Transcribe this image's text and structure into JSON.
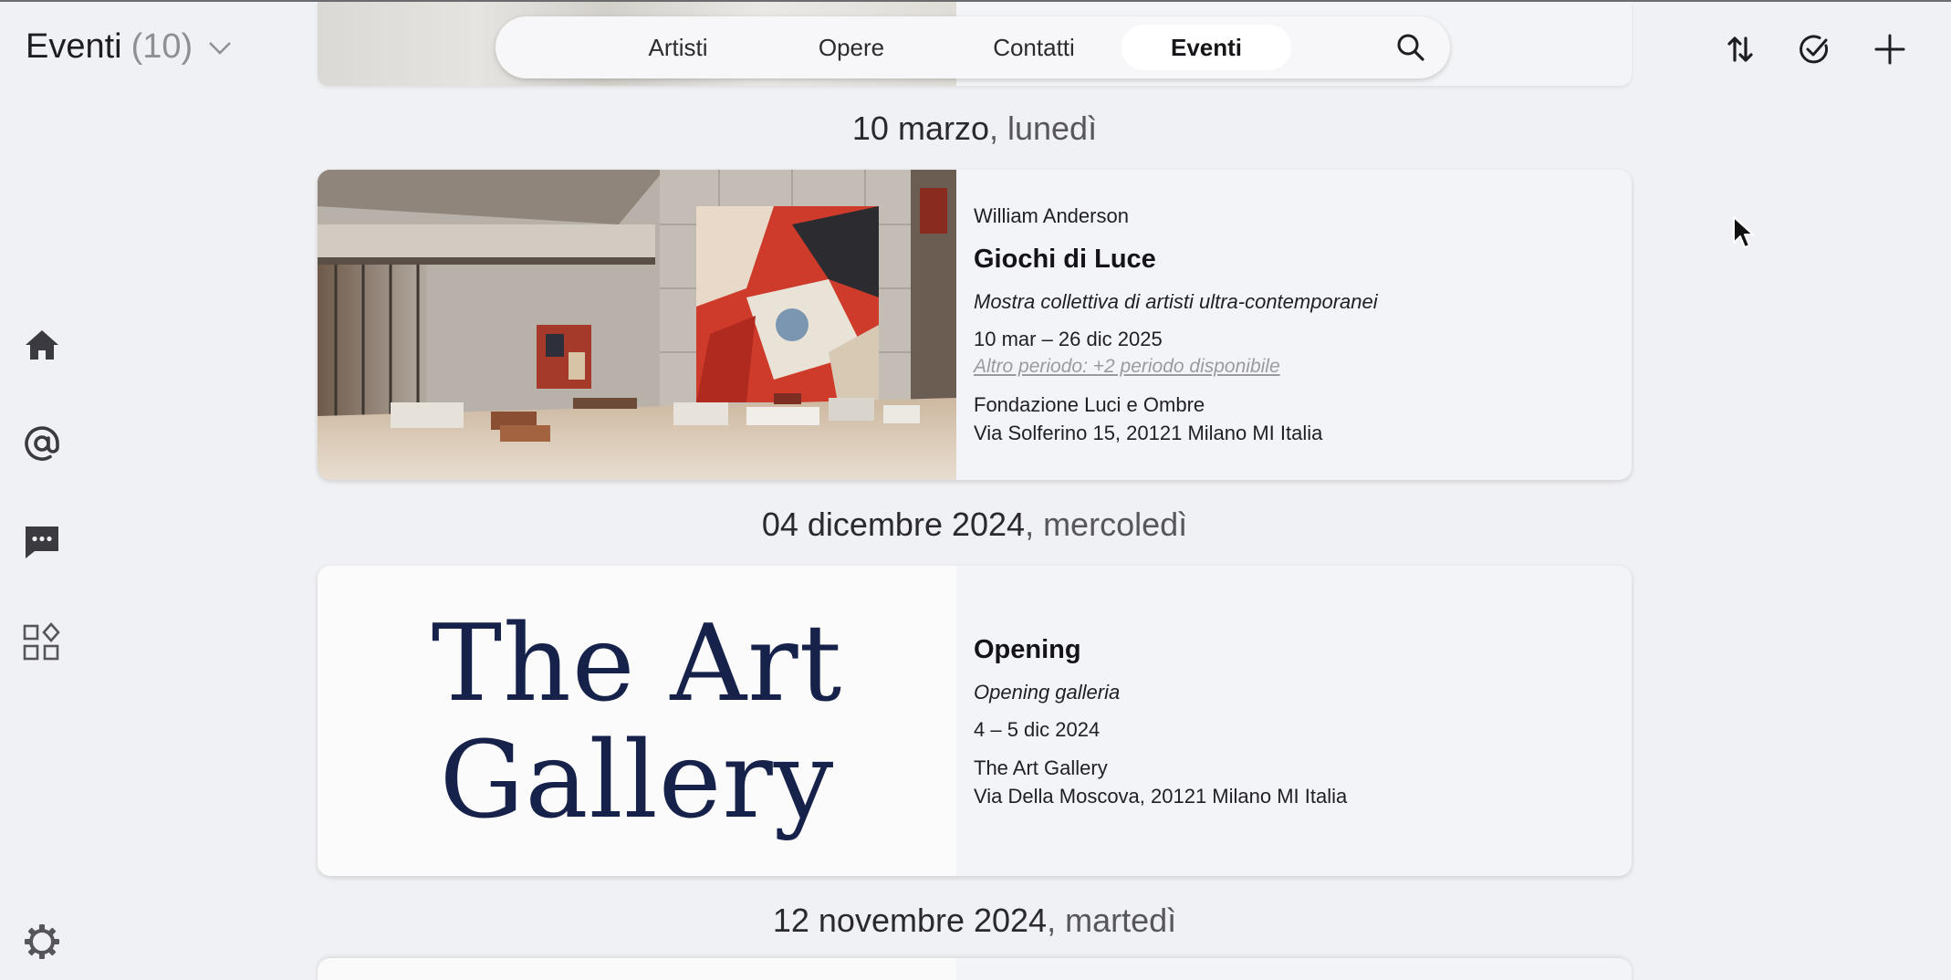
{
  "header": {
    "title": "Eventi",
    "count": "(10)",
    "nav_tabs": [
      {
        "label": "Artisti",
        "active": false
      },
      {
        "label": "Opere",
        "active": false
      },
      {
        "label": "Contatti",
        "active": false
      },
      {
        "label": "Eventi",
        "active": true
      }
    ],
    "actions": [
      "sort-icon",
      "check-circle-icon",
      "plus-icon"
    ]
  },
  "sidebar": {
    "items": [
      "home-icon",
      "at-icon",
      "chat-icon",
      "apps-icon"
    ],
    "bottom": "settings-icon"
  },
  "groups": [
    {
      "date": "10 marzo",
      "weekday": ", lunedì",
      "event": {
        "artist": "William Anderson",
        "title": "Giochi di Luce",
        "subtitle": "Mostra collettiva di artisti ultra-contemporanei",
        "dates": "10 mar – 26 dic 2025",
        "other_period": "Altro periodo: +2 periodo disponibile",
        "venue_name": "Fondazione Luci e Ombre",
        "venue_address": "Via Solferino 15, 20121 Milano MI Italia"
      }
    },
    {
      "date": "04 dicembre 2024",
      "weekday": ", mercoledì",
      "event": {
        "logo_line1": "The Art",
        "logo_line2": "Gallery",
        "title": "Opening",
        "subtitle": "Opening galleria",
        "dates": "4 – 5 dic 2024",
        "venue_name": "The Art Gallery",
        "venue_address": "Via Della Moscova, 20121 Milano MI Italia"
      }
    },
    {
      "date": "12 novembre 2024",
      "weekday": ", martedì"
    }
  ],
  "colors": {
    "background": "#f0f1f4",
    "card": "#f3f4f7",
    "logo_navy": "#17224a",
    "muted_link": "#9a9aa0"
  }
}
